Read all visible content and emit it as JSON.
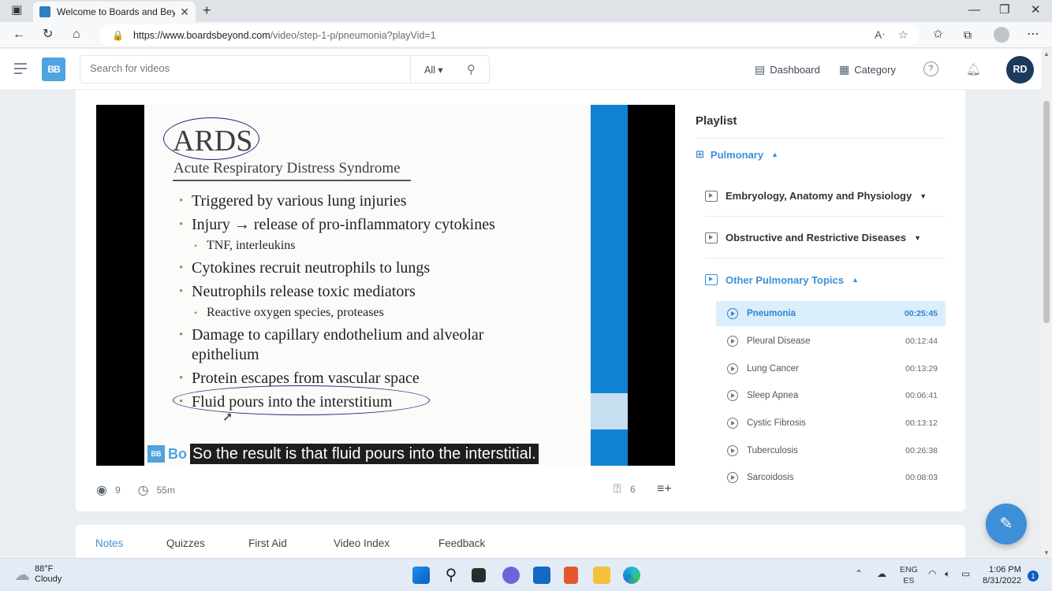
{
  "browser": {
    "tab_title": "Welcome to Boards and Beyond",
    "url_host": "https://www.boardsbeyond.com",
    "url_path": "/video/step-1-p/pneumonia?playVid=1"
  },
  "header": {
    "logo_text": "BB",
    "search_placeholder": "Search for videos",
    "search_filter": "All",
    "dashboard_label": "Dashboard",
    "category_label": "Category",
    "help_glyph": "?",
    "avatar_initials": "RD"
  },
  "slide": {
    "title": "ARDS",
    "subtitle": "Acute Respiratory Distress Syndrome",
    "bullets": [
      "Triggered by various lung injuries",
      "Injury → release of pro-inflammatory cytokines",
      "TNF, interleukins",
      "Cytokines recruit neutrophils to lungs",
      "Neutrophils release toxic mediators",
      "Reactive oxygen species, proteases",
      "Damage to capillary endothelium and alveolar epithelium",
      "Protein escapes from vascular space",
      "Fluid pours into the interstitium"
    ],
    "caption_logo": "BB",
    "caption_brand": "Bo",
    "caption": "So the result is that fluid pours into the interstitial."
  },
  "video_meta": {
    "views": "9",
    "duration": "55m",
    "questions": "6"
  },
  "playlist": {
    "title": "Playlist",
    "topic": "Pulmonary",
    "sections": [
      "Embryology, Anatomy and Physiology",
      "Obstructive and Restrictive Diseases",
      "Other Pulmonary Topics"
    ],
    "videos": [
      {
        "title": "Pneumonia",
        "duration": "00:25:45"
      },
      {
        "title": "Pleural Disease",
        "duration": "00:12:44"
      },
      {
        "title": "Lung Cancer",
        "duration": "00:13:29"
      },
      {
        "title": "Sleep Apnea",
        "duration": "00:06:41"
      },
      {
        "title": "Cystic Fibrosis",
        "duration": "00:13:12"
      },
      {
        "title": "Tuberculosis",
        "duration": "00:26:38"
      },
      {
        "title": "Sarcoidosis",
        "duration": "00:08:03"
      }
    ]
  },
  "tabs": [
    "Notes",
    "Quizzes",
    "First Aid",
    "Video Index",
    "Feedback"
  ],
  "taskbar": {
    "temp": "88°F",
    "condition": "Cloudy",
    "lang": "ENG",
    "region": "ES",
    "time": "1:06 PM",
    "date": "8/31/2022",
    "notifications": "1"
  },
  "colors": {
    "accent": "#3d8fd8",
    "avatar_bg": "#1b3a5c",
    "video_blue": "#0e83d4"
  }
}
